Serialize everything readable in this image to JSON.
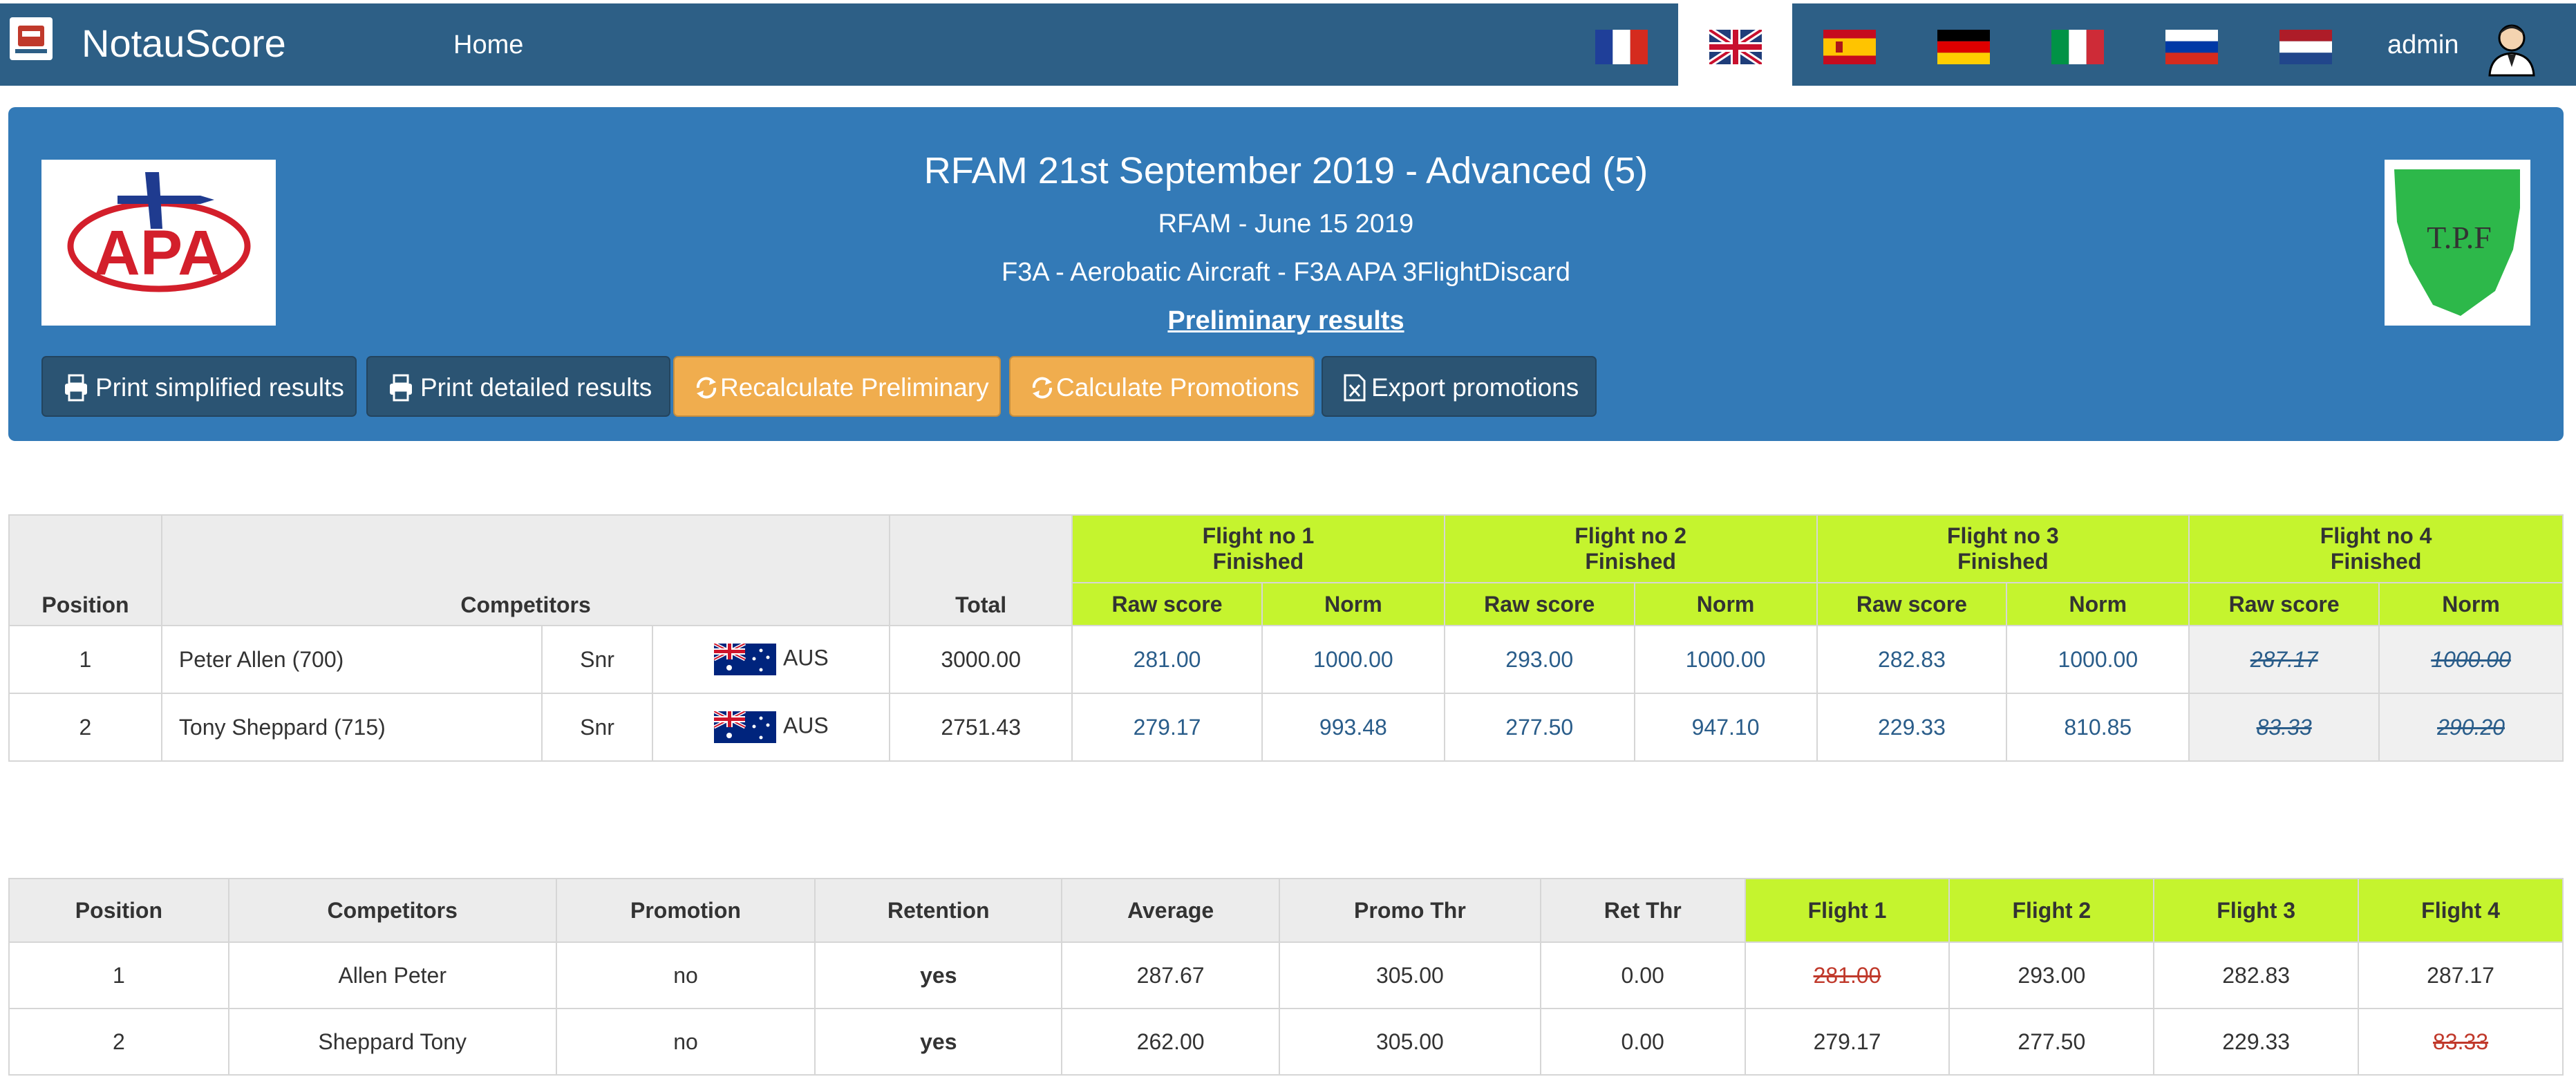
{
  "navbar": {
    "brand": "NotauScore",
    "home": "Home",
    "user": "admin",
    "flags": [
      "flag-france-icon",
      "flag-uk-icon",
      "flag-spain-icon",
      "flag-germany-icon",
      "flag-italy-icon",
      "flag-russia-icon",
      "flag-netherlands-icon"
    ],
    "active_flag": "flag-uk-icon"
  },
  "header": {
    "title": "RFAM 21st September 2019 - Advanced (5)",
    "subtitle": "RFAM - June 15 2019",
    "category": "F3A - Aerobatic Aircraft - F3A APA 3FlightDiscard",
    "status": "Preliminary results",
    "logo_left_text": "APA",
    "logo_right_text": "T.P.F"
  },
  "buttons": {
    "print_simplified": "Print simplified results",
    "print_detailed": "Print detailed results",
    "recalculate": "Recalculate Preliminary",
    "calc_promotions": "Calculate Promotions",
    "export_promotions": "Export promotions"
  },
  "results": {
    "col_position": "Position",
    "col_competitors": "Competitors",
    "col_total": "Total",
    "col_raw": "Raw score",
    "col_norm": "Norm",
    "flights": [
      {
        "label": "Flight no 1",
        "status": "Finished"
      },
      {
        "label": "Flight no 2",
        "status": "Finished"
      },
      {
        "label": "Flight no 3",
        "status": "Finished"
      },
      {
        "label": "Flight no 4",
        "status": "Finished"
      }
    ],
    "rows": [
      {
        "position": "1",
        "name": "Peter Allen (700)",
        "class": "Snr",
        "country": "AUS",
        "total": "3000.00",
        "scores": [
          [
            "281.00",
            "1000.00"
          ],
          [
            "293.00",
            "1000.00"
          ],
          [
            "282.83",
            "1000.00"
          ],
          [
            "287.17",
            "1000.00"
          ]
        ]
      },
      {
        "position": "2",
        "name": "Tony Sheppard (715)",
        "class": "Snr",
        "country": "AUS",
        "total": "2751.43",
        "scores": [
          [
            "279.17",
            "993.48"
          ],
          [
            "277.50",
            "947.10"
          ],
          [
            "229.33",
            "810.85"
          ],
          [
            "83.33",
            "290.20"
          ]
        ]
      }
    ]
  },
  "promotions": {
    "headers": [
      "Position",
      "Competitors",
      "Promotion",
      "Retention",
      "Average",
      "Promo Thr",
      "Ret Thr",
      "Flight 1",
      "Flight 2",
      "Flight 3",
      "Flight 4"
    ],
    "rows": [
      {
        "position": "1",
        "name": "Allen Peter",
        "promotion": "no",
        "retention": "yes",
        "average": "287.67",
        "promo_thr": "305.00",
        "ret_thr": "0.00",
        "flights": [
          "281.00",
          "293.00",
          "282.83",
          "287.17"
        ]
      },
      {
        "position": "2",
        "name": "Sheppard Tony",
        "promotion": "no",
        "retention": "yes",
        "average": "262.00",
        "promo_thr": "305.00",
        "ret_thr": "0.00",
        "flights": [
          "279.17",
          "277.50",
          "229.33",
          "83.33"
        ]
      }
    ]
  },
  "colors": {
    "navbar": "#2d5f86",
    "panel": "#337ab7",
    "flight_header": "#c5f42e",
    "warning_button": "#f0ad4e",
    "dark_button": "#2b5473",
    "link": "#2a5d8a",
    "strike_red": "#c0392b"
  }
}
